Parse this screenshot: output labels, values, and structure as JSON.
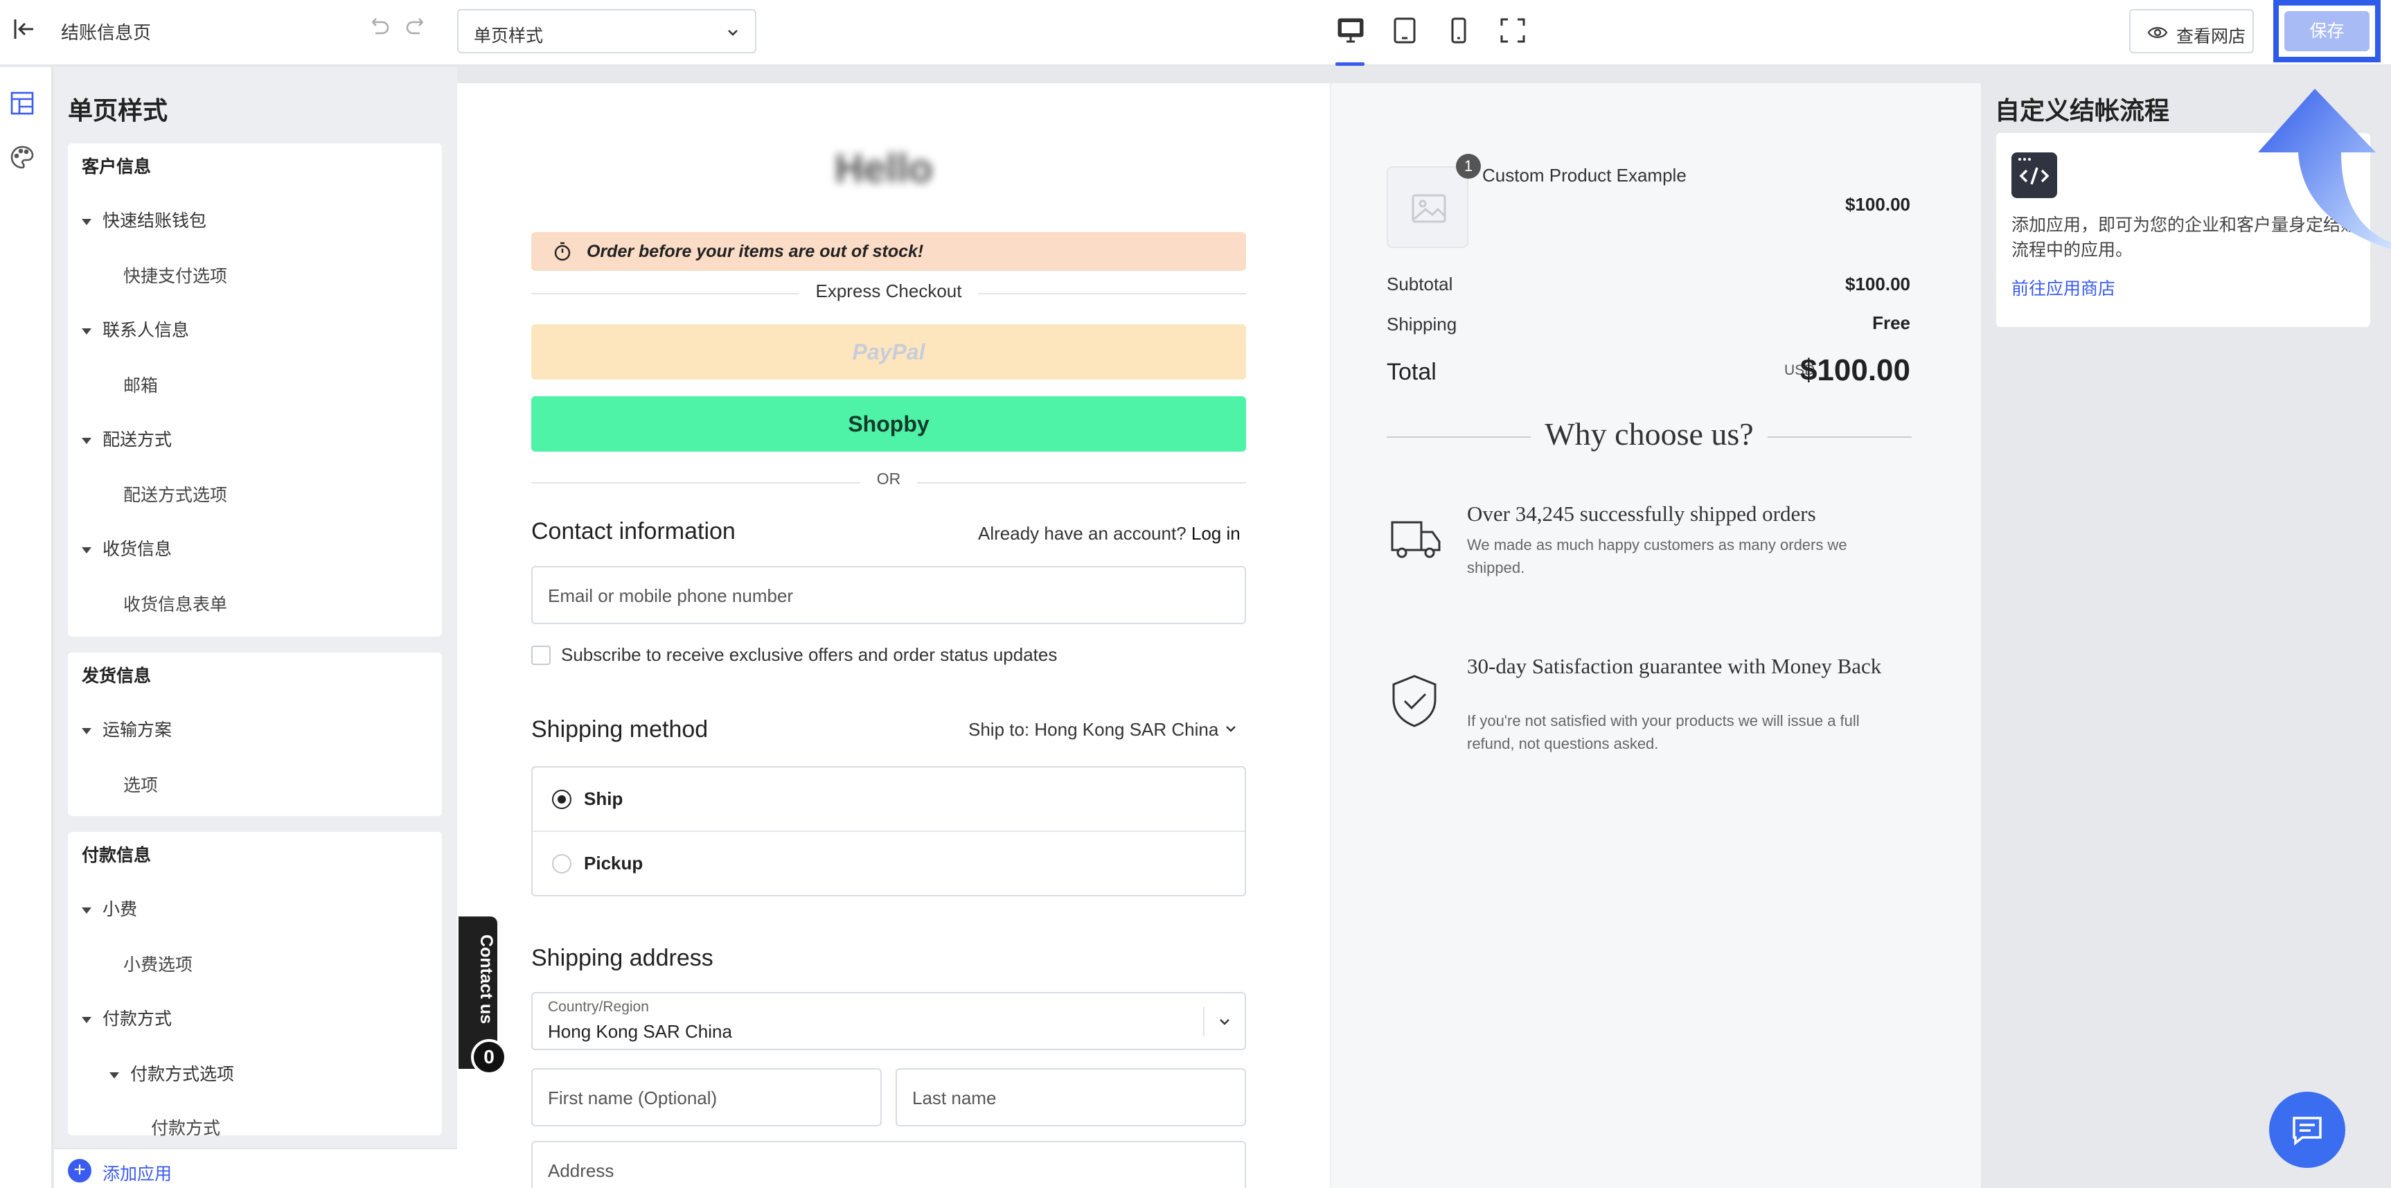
{
  "topbar": {
    "page_name": "结账信息页",
    "template_select": "单页样式",
    "view_store": "查看网店",
    "save": "保存"
  },
  "left_panel": {
    "title": "单页样式",
    "customer_section": {
      "title": "客户信息",
      "items": [
        {
          "group": "快速结账钱包",
          "sub": "快捷支付选项"
        },
        {
          "group": "联系人信息",
          "sub": "邮箱"
        },
        {
          "group": "配送方式",
          "sub": "配送方式选项"
        },
        {
          "group": "收货信息",
          "sub": "收货信息表单"
        }
      ]
    },
    "delivery_section": {
      "title": "发货信息",
      "items": [
        {
          "group": "运输方案",
          "sub": "选项"
        }
      ]
    },
    "payment_section": {
      "title": "付款信息",
      "tip_group": "小费",
      "tip_sub": "小费选项",
      "method_group": "付款方式",
      "method_sub_group": "付款方式选项",
      "method_leaf": "付款方式"
    },
    "add_app": "添加应用"
  },
  "checkout": {
    "logo_text": "Hello",
    "stock_banner": "Order before your items are out of stock!",
    "express_checkout": "Express Checkout",
    "paypal": "PayPal",
    "shopby": "Shopby",
    "or": "OR",
    "contact_title": "Contact information",
    "have_account": "Already have an account?",
    "log_in": "Log in",
    "email_placeholder": "Email or mobile phone number",
    "subscribe": "Subscribe to receive exclusive offers and order status updates",
    "shipping_method_title": "Shipping method",
    "ship_to": "Ship to: Hong Kong SAR China",
    "option_ship": "Ship",
    "option_pickup": "Pickup",
    "shipping_address_title": "Shipping address",
    "country_label": "Country/Region",
    "country_value": "Hong Kong SAR China",
    "first_name": "First name (Optional)",
    "last_name": "Last name",
    "address": "Address",
    "contact_tab": "Contact us",
    "contact_badge": "0"
  },
  "summary": {
    "qty": "1",
    "product_name": "Custom Product Example",
    "product_price": "$100.00",
    "subtotal_label": "Subtotal",
    "subtotal_value": "$100.00",
    "shipping_label": "Shipping",
    "shipping_value": "Free",
    "total_label": "Total",
    "currency": "USD",
    "total_value": "$100.00",
    "why_title": "Why choose us?",
    "feature1_title": "Over 34,245 successfully shipped orders",
    "feature1_desc": "We made as much happy customers as many orders we shipped.",
    "feature2_title": "30-day Satisfaction guarantee with Money Back",
    "feature2_desc": "If you're not satisfied with your products we will issue a full refund, not questions asked."
  },
  "right_panel": {
    "title": "自定义结帐流程",
    "desc": "添加应用，即可为您的企业和客户量身定结账流程中的应用。",
    "link": "前往应用商店"
  },
  "colors": {
    "accent": "#3a5bf0",
    "banner": "#fbdcc6",
    "paypal": "#fde6bd",
    "shopby": "#4ff3a7"
  }
}
